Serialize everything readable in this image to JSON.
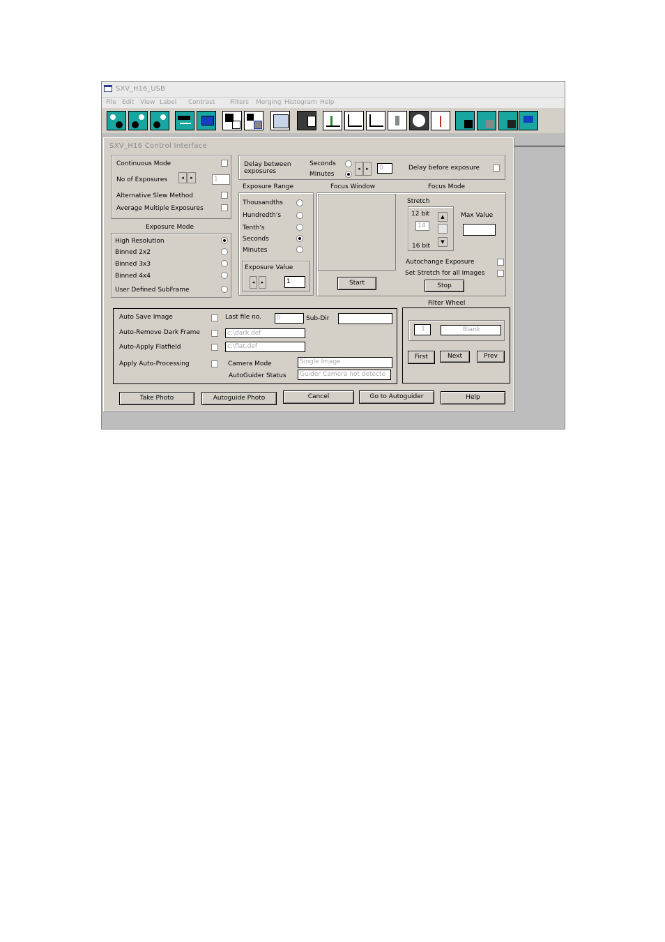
{
  "window": {
    "title": "SXV_H16_USB",
    "menu": [
      "File",
      "Edit",
      "View",
      "Label",
      "Contrast",
      "Filters",
      "Merging",
      "Histogram",
      "Help"
    ]
  },
  "dialog": {
    "title": "SXV_H16 Control Interface",
    "continuous_mode": "Continuous Mode",
    "no_of_exposures": "No of Exposures",
    "no_of_exposures_value": "1",
    "alt_slew": "Alternative Slew Method",
    "avg_multiple": "Average Multiple Exposures",
    "exposure_mode_title": "Exposure Mode",
    "exposure_modes": [
      "High Resolution",
      "Binned 2x2",
      "Binned 3x3",
      "Binned 4x4",
      "User Defined SubFrame"
    ],
    "delay_between": "Delay between exposures",
    "seconds": "Seconds",
    "minutes": "Minutes",
    "delay_value": "0",
    "delay_before": "Delay before exposure",
    "exposure_range_title": "Exposure Range",
    "exposure_ranges": [
      "Thousandths",
      "Hundredth's",
      "Tenth's",
      "Seconds",
      "Minutes"
    ],
    "exposure_value_title": "Exposure Value",
    "exposure_value": "1",
    "focus_window_title": "Focus Window",
    "start": "Start",
    "focus_mode_title": "Focus Mode",
    "stretch": "Stretch",
    "bit12": "12 bit",
    "bit16": "16 bit",
    "stretch_value": "14",
    "max_value": "Max Value",
    "autochange": "Autochange Exposure",
    "set_stretch": "Set Stretch for all Images",
    "stop": "Stop",
    "auto_save": "Auto Save Image",
    "last_file_no": "Last file no.",
    "last_file_value": "0",
    "sub_dir": "Sub-Dir",
    "auto_remove_dark": "Auto-Remove Dark Frame",
    "dark_file": "c:\\dark.def",
    "auto_apply_flat": "Auto-Apply Flatfield",
    "flat_file": "c:\\flat.def",
    "apply_auto_processing": "Apply Auto-Processing",
    "camera_mode": "Camera Mode",
    "camera_mode_value": "Single Image",
    "autoguider_status": "AutoGuider Status",
    "autoguider_status_value": "Guider Camera not detecte",
    "filter_wheel_title": "Filter Wheel",
    "filter_number": "1",
    "filter_name": "Blank",
    "first": "First",
    "next": "Next",
    "prev": "Prev",
    "take_photo": "Take Photo",
    "autoguide_photo": "Autoguide Photo",
    "cancel": "Cancel",
    "go_to_autoguider": "Go to Autoguider",
    "help": "Help"
  }
}
